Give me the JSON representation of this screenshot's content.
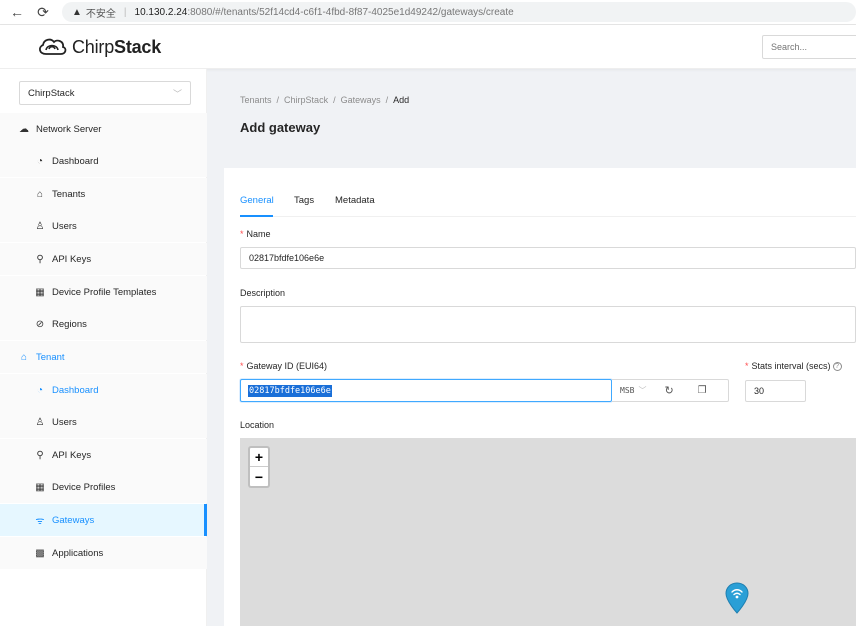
{
  "browser": {
    "back_icon": "arrow-left-icon",
    "reload_icon": "reload-icon",
    "warning": "▲",
    "insecure_label": "不安全",
    "host": "10.130.2.24",
    "path": ":8080/#/tenants/52f14cd4-c6f1-4fbd-8f87-4025e1d49242/gateways/create"
  },
  "header": {
    "brand_light": "Chirp",
    "brand_bold": "Stack",
    "search_placeholder": "Search..."
  },
  "sidebar": {
    "tenant_select": "ChirpStack",
    "network_server": {
      "label": "Network Server",
      "icon": "cloud-icon",
      "items": [
        {
          "label": "Dashboard",
          "icon": "dashboard-icon"
        },
        {
          "label": "Tenants",
          "icon": "home-icon"
        },
        {
          "label": "Users",
          "icon": "user-icon"
        },
        {
          "label": "API Keys",
          "icon": "key-icon"
        },
        {
          "label": "Device Profile Templates",
          "icon": "template-icon"
        },
        {
          "label": "Regions",
          "icon": "compass-icon"
        }
      ]
    },
    "tenant": {
      "label": "Tenant",
      "icon": "home-icon",
      "items": [
        {
          "label": "Dashboard",
          "icon": "dashboard-icon"
        },
        {
          "label": "Users",
          "icon": "user-icon"
        },
        {
          "label": "API Keys",
          "icon": "key-icon"
        },
        {
          "label": "Device Profiles",
          "icon": "template-icon"
        },
        {
          "label": "Gateways",
          "icon": "wifi-icon",
          "active": true
        },
        {
          "label": "Applications",
          "icon": "apps-icon"
        }
      ]
    }
  },
  "breadcrumb": [
    "Tenants",
    "ChirpStack",
    "Gateways",
    "Add"
  ],
  "page_title": "Add gateway",
  "tabs": [
    "General",
    "Tags",
    "Metadata"
  ],
  "form": {
    "name_label": "Name",
    "name_value": "02817bfdfe106e6e",
    "description_label": "Description",
    "description_value": "",
    "gateway_id_label": "Gateway ID (EUI64)",
    "gateway_id_value": "02817bfdfe106e6e",
    "byte_order": "MSB",
    "stats_label": "Stats interval (secs)",
    "stats_value": "30",
    "location_label": "Location",
    "required_mark": "*"
  },
  "map": {
    "zoom_in": "+",
    "zoom_out": "−"
  },
  "colors": {
    "primary": "#1890ff",
    "required": "#ff4d4f",
    "map_bg": "#dcdcdc"
  }
}
